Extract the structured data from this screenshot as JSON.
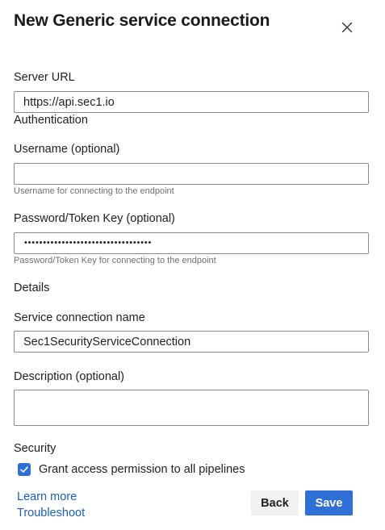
{
  "dialog": {
    "title": "New Generic service connection"
  },
  "server": {
    "label": "Server URL",
    "value": "https://api.sec1.io"
  },
  "authentication": {
    "heading": "Authentication",
    "username": {
      "label": "Username (optional)",
      "value": "",
      "hint": "Username for connecting to the endpoint"
    },
    "password": {
      "label": "Password/Token Key (optional)",
      "masked_value": "••••••••••••••••••••••••••••••••••",
      "hint": "Password/Token Key for connecting to the endpoint"
    }
  },
  "details": {
    "heading": "Details",
    "connection_name": {
      "label": "Service connection name",
      "value": "Sec1SecurityServiceConnection"
    },
    "description": {
      "label": "Description (optional)",
      "value": ""
    }
  },
  "security": {
    "heading": "Security",
    "grant_access": {
      "label": "Grant access permission to all pipelines",
      "checked": true
    }
  },
  "footer": {
    "learn_more": "Learn more",
    "troubleshoot": "Troubleshoot",
    "back_label": "Back",
    "save_label": "Save"
  },
  "icons": {
    "close": "close-icon",
    "check": "checkmark-icon"
  },
  "colors": {
    "accent": "#2f6fd6",
    "link": "#1c5fb8",
    "hint": "#707070",
    "back_button_bg": "#f1f1f1"
  }
}
